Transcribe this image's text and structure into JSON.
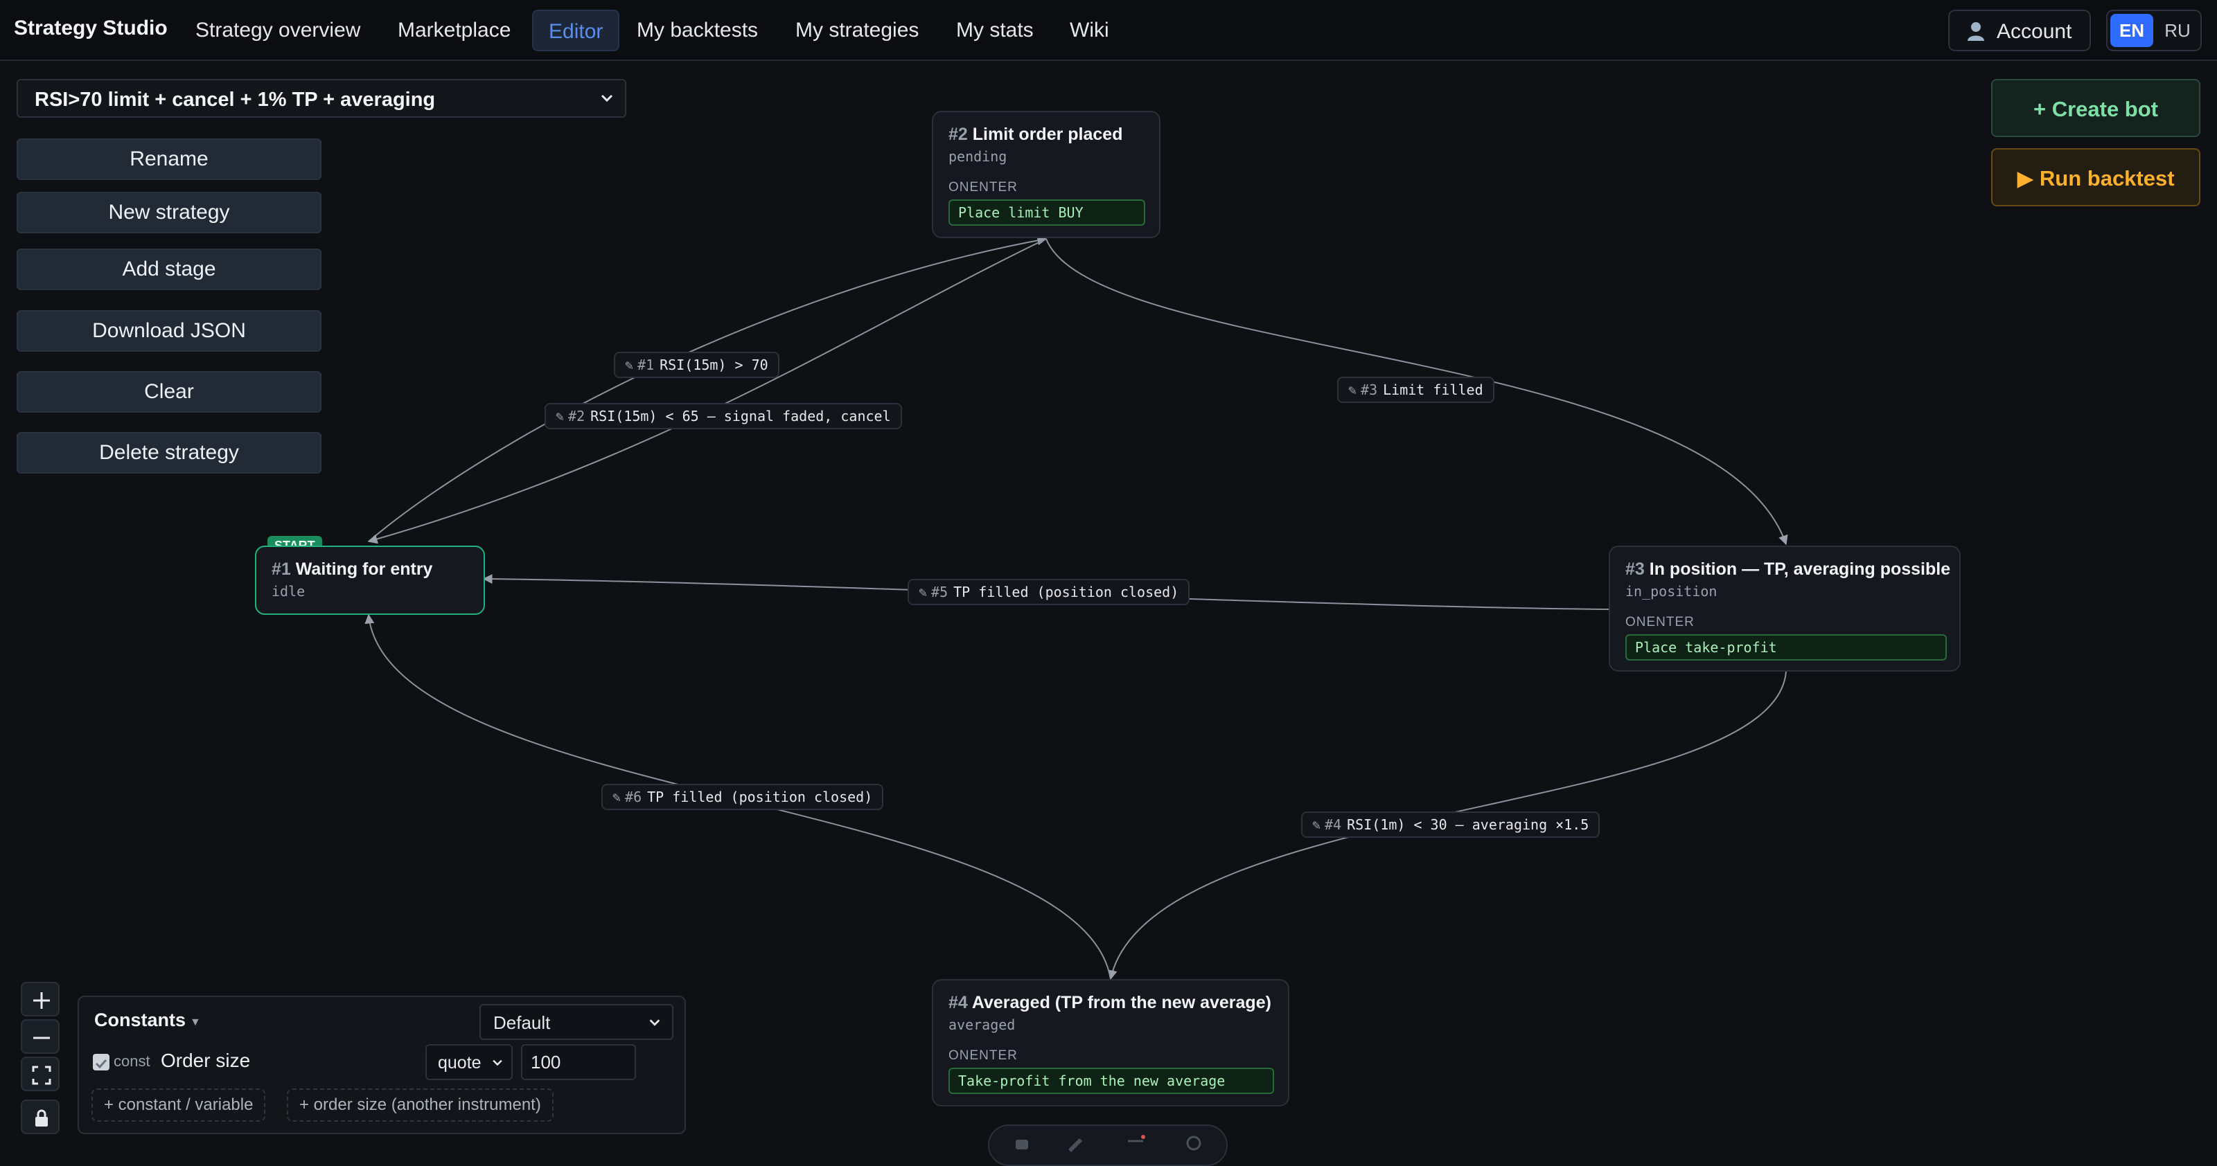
{
  "topbar": {
    "brand": "Strategy Studio",
    "nav": [
      {
        "label": "Strategy overview",
        "active": false
      },
      {
        "label": "Marketplace",
        "active": false
      },
      {
        "label": "Editor",
        "active": true
      },
      {
        "label": "My backtests",
        "active": false
      },
      {
        "label": "My strategies",
        "active": false
      },
      {
        "label": "My stats",
        "active": false
      },
      {
        "label": "Wiki",
        "active": false
      }
    ],
    "account_label": "Account",
    "languages": [
      "EN",
      "RU"
    ],
    "active_language": "EN"
  },
  "sidebar": {
    "strategy_name": "RSI>70 limit + cancel + 1% TP + averaging",
    "buttons": [
      "Rename",
      "New strategy",
      "Add stage",
      "Download JSON",
      "Clear",
      "Delete strategy"
    ]
  },
  "actions": {
    "create_bot": "+ Create bot",
    "run_backtest": "▶ Run backtest"
  },
  "graph": {
    "start_badge": "START",
    "onenter_label": "ONENTER",
    "nodes": [
      {
        "id": "#1",
        "title": "Waiting for entry",
        "state": "idle",
        "action": ""
      },
      {
        "id": "#2",
        "title": "Limit order placed",
        "state": "pending",
        "action": "Place limit BUY"
      },
      {
        "id": "#3",
        "title": "In position — TP, averaging possible",
        "state": "in_position",
        "action": "Place take-profit"
      },
      {
        "id": "#4",
        "title": "Averaged (TP from the new average)",
        "state": "averaged",
        "action": "Take-profit from the new average"
      }
    ],
    "edges": [
      {
        "id": "#1",
        "label": "RSI(15m) > 70"
      },
      {
        "id": "#2",
        "label": "RSI(15m) < 65 — signal faded, cancel"
      },
      {
        "id": "#3",
        "label": "Limit filled"
      },
      {
        "id": "#4",
        "label": "RSI(1m) < 30 — averaging ×1.5"
      },
      {
        "id": "#5",
        "label": "TP filled (position closed)"
      },
      {
        "id": "#6",
        "label": "TP filled (position closed)"
      }
    ]
  },
  "constants": {
    "title": "Constants",
    "preset": "Default",
    "items": [
      {
        "kind": "const",
        "name": "Order size",
        "unit": "quote",
        "value": "100"
      }
    ],
    "add_constant": "+ constant / variable",
    "add_order_size": "+ order size (another instrument)"
  },
  "colors": {
    "accent": "#2f6bff",
    "start_border": "#1fb37d",
    "create_bot": "#7fe0a6",
    "run_backtest": "#ffb02e",
    "action_text": "#a9f0b9"
  }
}
